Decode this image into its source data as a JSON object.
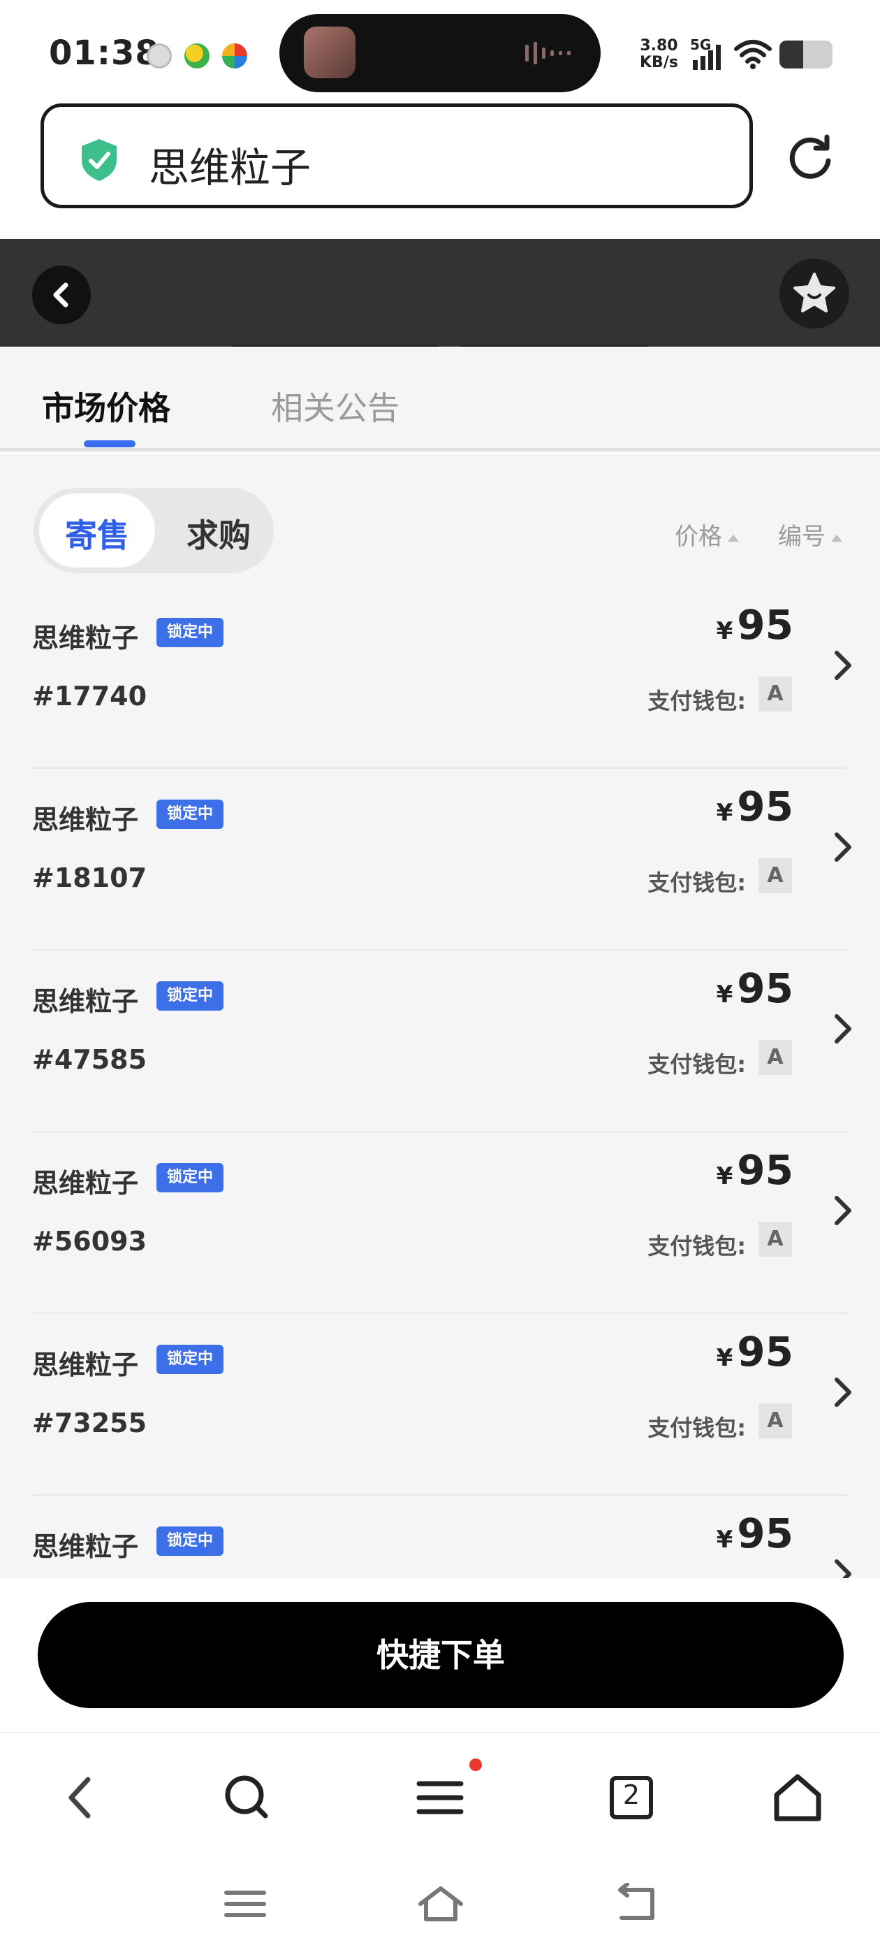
{
  "status_bar": {
    "time": "01:38",
    "speed_value": "3.80",
    "speed_unit": "KB/s",
    "network": "5G",
    "battery_percent": 45,
    "notification_icons": [
      "camera-app-icon",
      "green-yellow-app-icon",
      "multicolor-app-icon"
    ]
  },
  "browser": {
    "url_title": "思维粒子",
    "secure_icon": "shield-check-icon",
    "reload_icon": "reload-icon"
  },
  "header": {
    "back_icon": "chevron-left-icon",
    "favorite_icon": "star-icon"
  },
  "tabs": [
    {
      "label": "市场价格",
      "active": true
    },
    {
      "label": "相关公告",
      "active": false
    }
  ],
  "filter": {
    "segments": [
      {
        "label": "寄售",
        "active": true
      },
      {
        "label": "求购",
        "active": false
      }
    ],
    "sort_price": "价格",
    "sort_number": "编号"
  },
  "listings": [
    {
      "name": "思维粒子",
      "badge": "锁定中",
      "id": "#17740",
      "currency": "¥",
      "price": "95",
      "wallet_label": "支付钱包:",
      "wallet": "A"
    },
    {
      "name": "思维粒子",
      "badge": "锁定中",
      "id": "#18107",
      "currency": "¥",
      "price": "95",
      "wallet_label": "支付钱包:",
      "wallet": "A"
    },
    {
      "name": "思维粒子",
      "badge": "锁定中",
      "id": "#47585",
      "currency": "¥",
      "price": "95",
      "wallet_label": "支付钱包:",
      "wallet": "A"
    },
    {
      "name": "思维粒子",
      "badge": "锁定中",
      "id": "#56093",
      "currency": "¥",
      "price": "95",
      "wallet_label": "支付钱包:",
      "wallet": "A"
    },
    {
      "name": "思维粒子",
      "badge": "锁定中",
      "id": "#73255",
      "currency": "¥",
      "price": "95",
      "wallet_label": "支付钱包:",
      "wallet": "A"
    },
    {
      "name": "思维粒子",
      "badge": "锁定中",
      "id": "",
      "currency": "¥",
      "price": "95",
      "wallet_label": "",
      "wallet": ""
    }
  ],
  "action": {
    "order_label": "快捷下单"
  },
  "toolbar": {
    "tab_count": "2",
    "icons": [
      "back-icon",
      "search-icon",
      "menu-icon",
      "tabs-icon",
      "home-icon"
    ]
  },
  "colors": {
    "accent_blue": "#3c6fe8",
    "header_dark": "#333333",
    "badge_red_dot": "#e8392b"
  }
}
